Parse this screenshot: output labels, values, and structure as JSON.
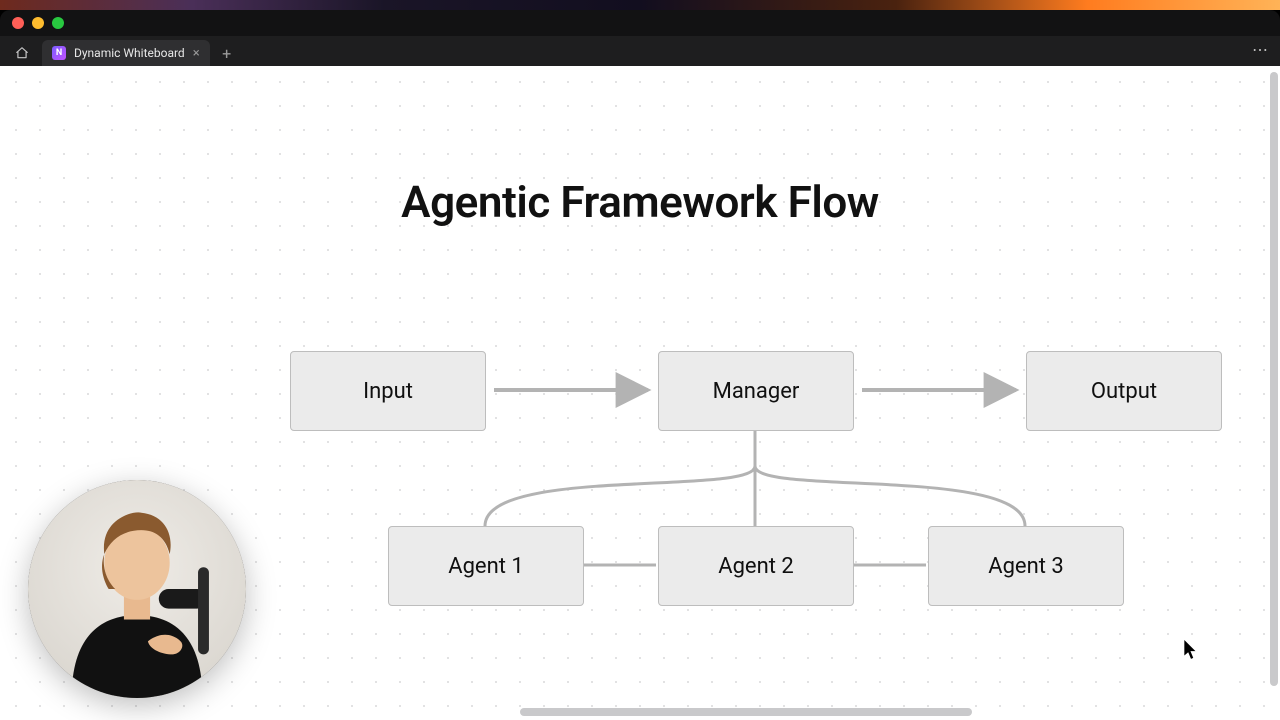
{
  "tab": {
    "title": "Dynamic Whiteboard"
  },
  "diagram": {
    "title": "Agentic Framework Flow",
    "nodes": {
      "input": "Input",
      "manager": "Manager",
      "output": "Output",
      "agent1": "Agent 1",
      "agent2": "Agent 2",
      "agent3": "Agent 3"
    }
  }
}
